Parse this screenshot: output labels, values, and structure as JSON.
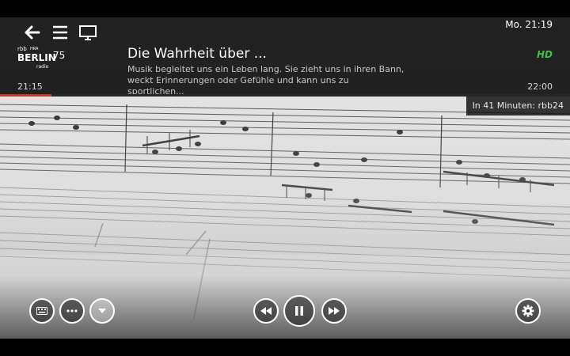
{
  "channel": {
    "logo_lines": [
      "rbb",
      "BERLIN",
      "radio"
    ],
    "logo_tag": "HRA",
    "number": "75"
  },
  "program": {
    "title": "Die Wahrheit über ...",
    "description": "Musik begleitet uns ein Leben lang. Sie zieht uns in ihren Bann, weckt Erinnerungen oder Gefühle und kann uns zu sportlichen...",
    "start_time": "21:15",
    "end_time": "22:00",
    "quality_badge": "HD",
    "progress_fraction": 0.09
  },
  "clock": "Mo. 21:19",
  "up_next": "In 41 Minuten: rbb24",
  "icons": {
    "back": "arrow-left-icon",
    "menu": "hamburger-menu-icon",
    "tv": "tv-screen-icon",
    "keyboard": "keyboard-icon",
    "more": "ellipsis-icon",
    "dropdown": "caret-down-icon",
    "rewind": "rewind-icon",
    "pause": "pause-icon",
    "forward": "fast-forward-icon",
    "settings": "gear-icon"
  },
  "colors": {
    "hd_badge": "#3fbf3f",
    "progress": "#c0392b",
    "overlay": "#121212"
  }
}
